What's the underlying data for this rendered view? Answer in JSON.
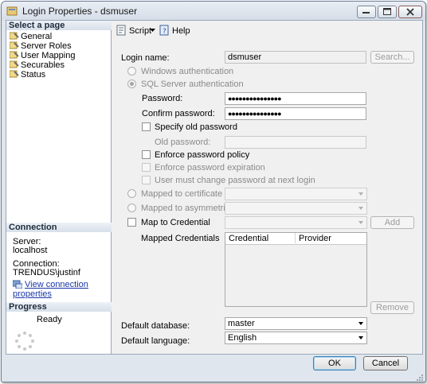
{
  "window": {
    "title": "Login Properties - dsmuser"
  },
  "left": {
    "select_page_header": "Select a page",
    "pages": [
      {
        "label": "General",
        "icon": "wrench-page-icon"
      },
      {
        "label": "Server Roles",
        "icon": "wrench-page-icon"
      },
      {
        "label": "User Mapping",
        "icon": "wrench-page-icon"
      },
      {
        "label": "Securables",
        "icon": "wrench-page-icon"
      },
      {
        "label": "Status",
        "icon": "wrench-page-icon"
      }
    ],
    "connection_header": "Connection",
    "server_label": "Server:",
    "server_value": "localhost",
    "connection_label": "Connection:",
    "connection_value": "TRENDUS\\justinf",
    "view_props_link": "View connection properties",
    "progress_header": "Progress",
    "progress_status": "Ready"
  },
  "toolbar": {
    "script_label": "Script",
    "help_label": "Help"
  },
  "form": {
    "login_name_label": "Login name:",
    "login_name_value": "dsmuser",
    "search_button": "Search...",
    "windows_auth": "Windows authentication",
    "sql_auth": "SQL Server authentication",
    "password_label": "Password:",
    "password_value": "●●●●●●●●●●●●●●●",
    "confirm_label": "Confirm password:",
    "confirm_value": "●●●●●●●●●●●●●●●",
    "specify_old": "Specify old password",
    "old_password_label": "Old password:",
    "enforce_policy": "Enforce password policy",
    "enforce_expiration": "Enforce password expiration",
    "must_change": "User must change password at next login",
    "mapped_cert": "Mapped to certificate",
    "mapped_asym": "Mapped to asymmetric key",
    "map_credential": "Map to Credential",
    "add_button": "Add",
    "mapped_credentials_label": "Mapped Credentials",
    "grid_columns": [
      "Credential",
      "Provider"
    ],
    "remove_button": "Remove",
    "default_db_label": "Default database:",
    "default_db_value": "master",
    "default_lang_label": "Default language:",
    "default_lang_value": "English"
  },
  "footer": {
    "ok": "OK",
    "cancel": "Cancel"
  }
}
